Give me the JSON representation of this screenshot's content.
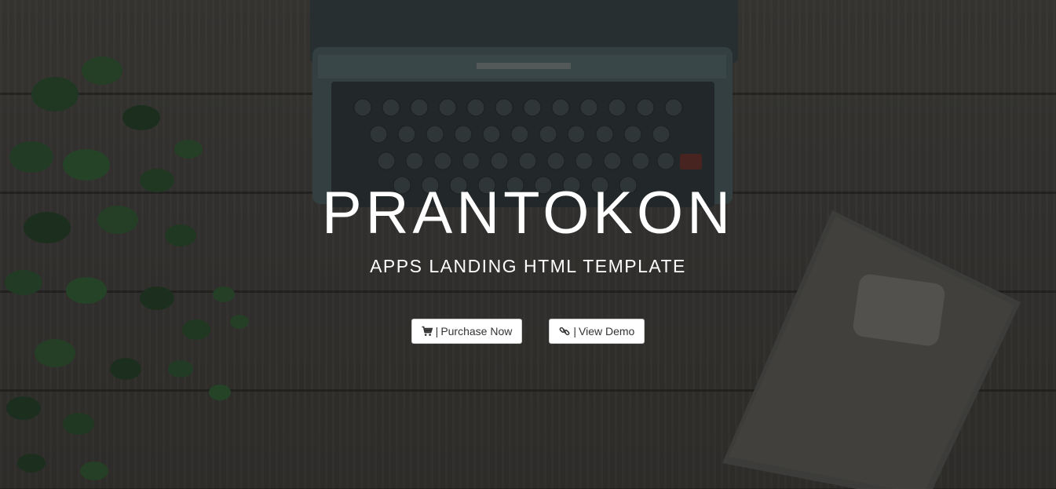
{
  "hero": {
    "title": "PRANTOKON",
    "subtitle": "APPS LANDING HTML TEMPLATE",
    "buttons": [
      {
        "icon": "cart-icon",
        "separator": "|",
        "label": "Purchase Now"
      },
      {
        "icon": "link-icon",
        "separator": "|",
        "label": "View Demo"
      }
    ]
  },
  "colors": {
    "text": "#ffffff",
    "button_bg": "#ffffff",
    "button_text": "#333333",
    "background": "#3b3936"
  }
}
